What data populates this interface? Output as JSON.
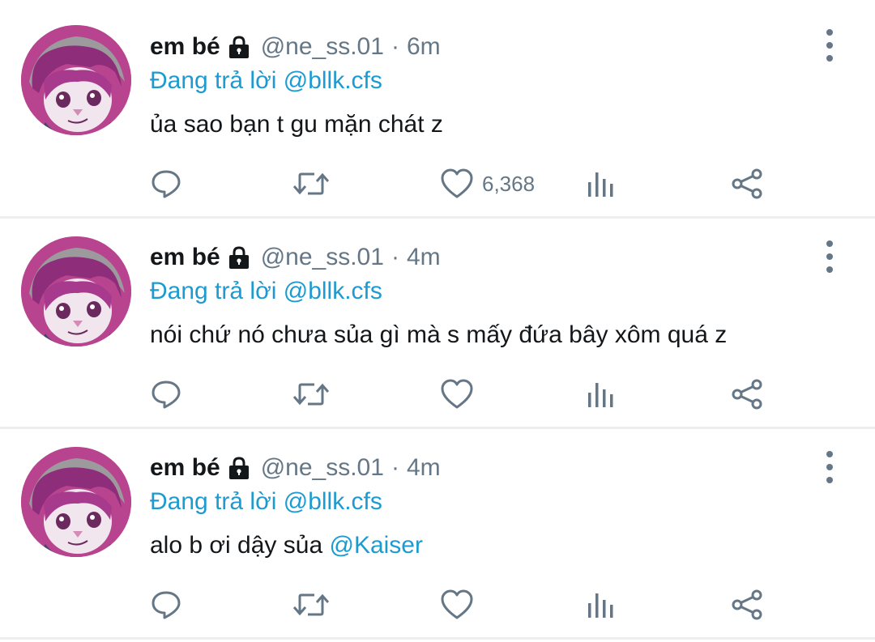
{
  "tweets": [
    {
      "name": "em bé",
      "handle": "@ne_ss.01",
      "separator": "·",
      "time": "6m",
      "reply_prefix": "Đang trả lời",
      "reply_to": "@bllk.cfs",
      "text": "ủa sao bạn t gu mặn chát z",
      "mention": "",
      "likes": "6,368"
    },
    {
      "name": "em bé",
      "handle": "@ne_ss.01",
      "separator": "·",
      "time": "4m",
      "reply_prefix": "Đang trả lời",
      "reply_to": "@bllk.cfs",
      "text": "nói chứ nó chưa sủa gì mà s mấy đứa bây xôm quá z",
      "mention": "",
      "likes": ""
    },
    {
      "name": "em bé",
      "handle": "@ne_ss.01",
      "separator": "·",
      "time": "4m",
      "reply_prefix": "Đang trả lời",
      "reply_to": "@bllk.cfs",
      "text": "alo b ơi dậy sủa ",
      "mention": "@Kaiser",
      "likes": ""
    }
  ],
  "icons": {
    "reply": "reply-icon",
    "retweet": "retweet-icon",
    "like": "heart-icon",
    "views": "analytics-icon",
    "share": "share-icon",
    "more": "more-vertical-icon",
    "lock": "lock-icon"
  },
  "colors": {
    "accent": "#1d9bd1",
    "muted": "#657786",
    "text": "#14171a",
    "divider": "#eceeef"
  }
}
